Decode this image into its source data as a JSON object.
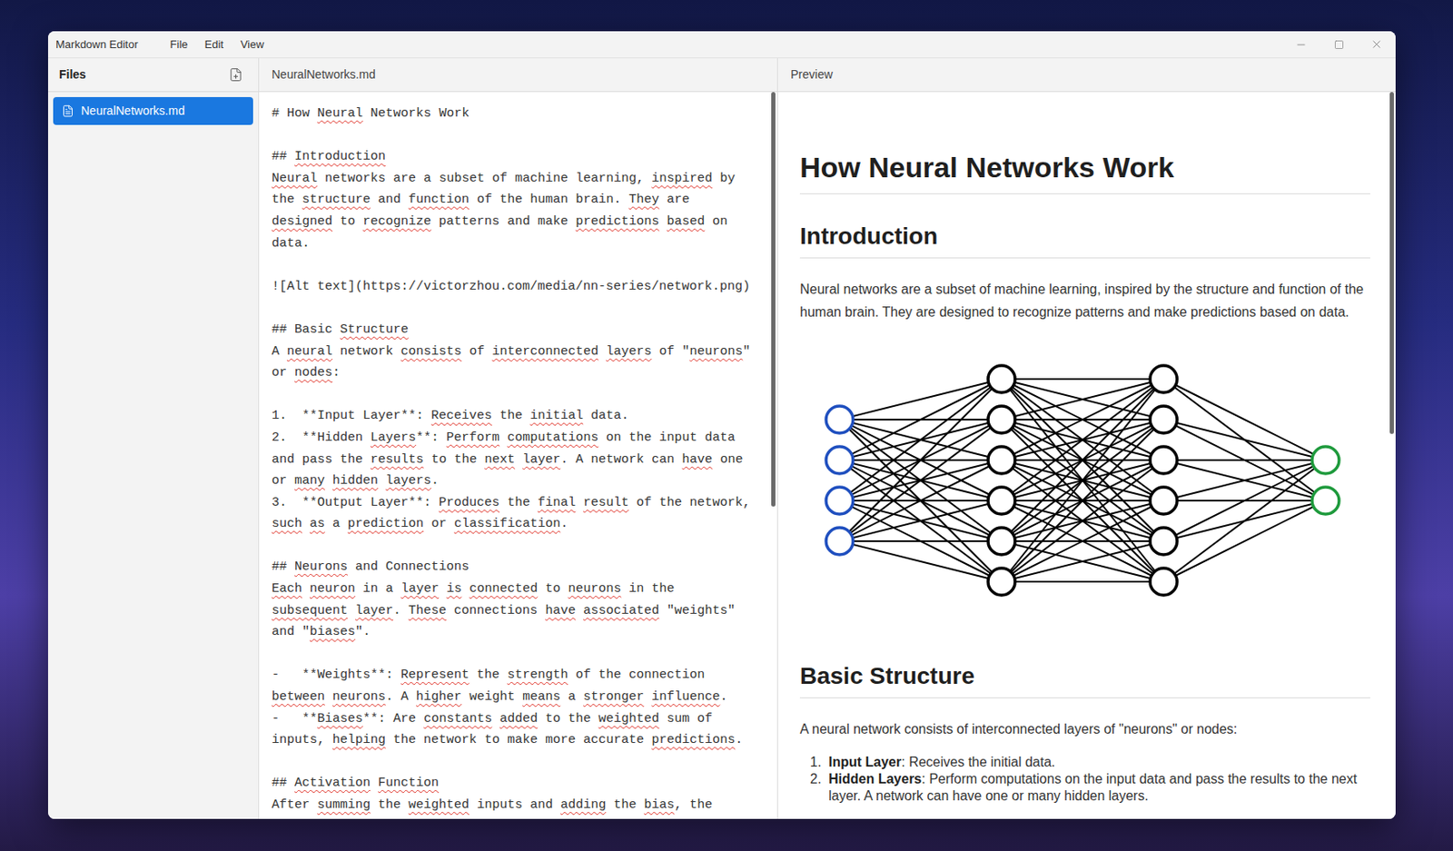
{
  "window": {
    "title": "Markdown Editor"
  },
  "menu": [
    "File",
    "Edit",
    "View"
  ],
  "sidebar": {
    "title": "Files",
    "items": [
      {
        "label": "NeuralNetworks.md",
        "selected": true
      }
    ]
  },
  "editor": {
    "tab": "NeuralNetworks.md",
    "scrollbar": {
      "offset": 0,
      "size": 0.57
    },
    "lines": [
      {
        "text": "# How Neural Networks Work",
        "misspelled": [
          "Neural"
        ]
      },
      {
        "text": "",
        "misspelled": []
      },
      {
        "text": "## Introduction",
        "misspelled": [
          "Introduction"
        ]
      },
      {
        "text": "Neural networks are a subset of machine learning, inspired by",
        "misspelled": [
          "Neural",
          "inspired"
        ]
      },
      {
        "text": "the structure and function of the human brain. They are",
        "misspelled": [
          "structure",
          "function",
          "They"
        ]
      },
      {
        "text": "designed to recognize patterns and make predictions based on",
        "misspelled": [
          "designed",
          "recognize",
          "predictions",
          "based"
        ]
      },
      {
        "text": "data.",
        "misspelled": []
      },
      {
        "text": "",
        "misspelled": []
      },
      {
        "text": "![Alt text](https://victorzhou.com/media/nn-series/network.png)",
        "misspelled": []
      },
      {
        "text": "",
        "misspelled": []
      },
      {
        "text": "## Basic Structure",
        "misspelled": [
          "Structure"
        ]
      },
      {
        "text": "A neural network consists of interconnected layers of \"neurons\"",
        "misspelled": [
          "neural",
          "consists",
          "interconnected",
          "layers",
          "neurons"
        ]
      },
      {
        "text": "or nodes:",
        "misspelled": [
          "nodes"
        ]
      },
      {
        "text": "",
        "misspelled": []
      },
      {
        "text": "1.  **Input Layer**: Receives the initial data.",
        "misspelled": [
          "Receives",
          "initial"
        ]
      },
      {
        "text": "2.  **Hidden Layers**: Perform computations on the input data",
        "misspelled": [
          "Layers",
          "Perform",
          "computations"
        ]
      },
      {
        "text": "and pass the results to the next layer. A network can have one",
        "misspelled": [
          "results",
          "next",
          "layer",
          "have"
        ]
      },
      {
        "text": "or many hidden layers.",
        "misspelled": [
          "many",
          "hidden",
          "layers"
        ]
      },
      {
        "text": "3.  **Output Layer**: Produces the final result of the network,",
        "misspelled": [
          "Produces",
          "final",
          "result"
        ]
      },
      {
        "text": "such as a prediction or classification.",
        "misspelled": [
          "such",
          "as",
          "prediction",
          "classification"
        ]
      },
      {
        "text": "",
        "misspelled": []
      },
      {
        "text": "## Neurons and Connections",
        "misspelled": [
          "Neurons"
        ]
      },
      {
        "text": "Each neuron in a layer is connected to neurons in the",
        "misspelled": [
          "Each",
          "neuron",
          "layer",
          "is",
          "connected",
          "neurons"
        ]
      },
      {
        "text": "subsequent layer. These connections have associated \"weights\"",
        "misspelled": [
          "subsequent",
          "layer",
          "These",
          "have",
          "associated"
        ]
      },
      {
        "text": "and \"biases\".",
        "misspelled": [
          "biases"
        ]
      },
      {
        "text": "",
        "misspelled": []
      },
      {
        "text": "-   **Weights**: Represent the strength of the connection",
        "misspelled": [
          "Represent",
          "strength"
        ]
      },
      {
        "text": "between neurons. A higher weight means a stronger influence.",
        "misspelled": [
          "between",
          "neurons",
          "higher",
          "means",
          "stronger",
          "influence"
        ]
      },
      {
        "text": "-   **Biases**: Are constants added to the weighted sum of",
        "misspelled": [
          "Biases",
          "constants",
          "added",
          "weighted"
        ]
      },
      {
        "text": "inputs, helping the network to make more accurate predictions.",
        "misspelled": [
          "helping",
          "predictions"
        ]
      },
      {
        "text": "",
        "misspelled": []
      },
      {
        "text": "## Activation Function",
        "misspelled": [
          "Activation",
          "Function"
        ]
      },
      {
        "text": "After summing the weighted inputs and adding the bias, the",
        "misspelled": [
          "summing",
          "weighted",
          "adding",
          "bias"
        ]
      }
    ]
  },
  "preview": {
    "tab": "Preview",
    "scrollbar": {
      "offset": 0,
      "size": 0.47
    },
    "blocks": [
      {
        "kind": "h1",
        "text": "How Neural Networks Work"
      },
      {
        "kind": "h2",
        "text": "Introduction"
      },
      {
        "kind": "p",
        "text": "Neural networks are a subset of machine learning, inspired by the structure and function of the human brain. They are designed to recognize patterns and make predictions based on data."
      },
      {
        "kind": "image",
        "layers": [
          {
            "nodes": 4,
            "color": "#1f4fbf"
          },
          {
            "nodes": 6,
            "color": "#000000"
          },
          {
            "nodes": 6,
            "color": "#000000"
          },
          {
            "nodes": 2,
            "color": "#1e9a3c"
          }
        ]
      },
      {
        "kind": "h2",
        "text": "Basic Structure"
      },
      {
        "kind": "p",
        "text": "A neural network consists of interconnected layers of \"neurons\" or nodes:"
      },
      {
        "kind": "ol",
        "items": [
          {
            "number": "1.",
            "label": "Input Layer",
            "text": ": Receives the initial data."
          },
          {
            "number": "2.",
            "label": "Hidden Layers",
            "text": ": Perform computations on the input data and pass the results to the next layer. A network can have one or many hidden layers."
          }
        ]
      }
    ]
  }
}
